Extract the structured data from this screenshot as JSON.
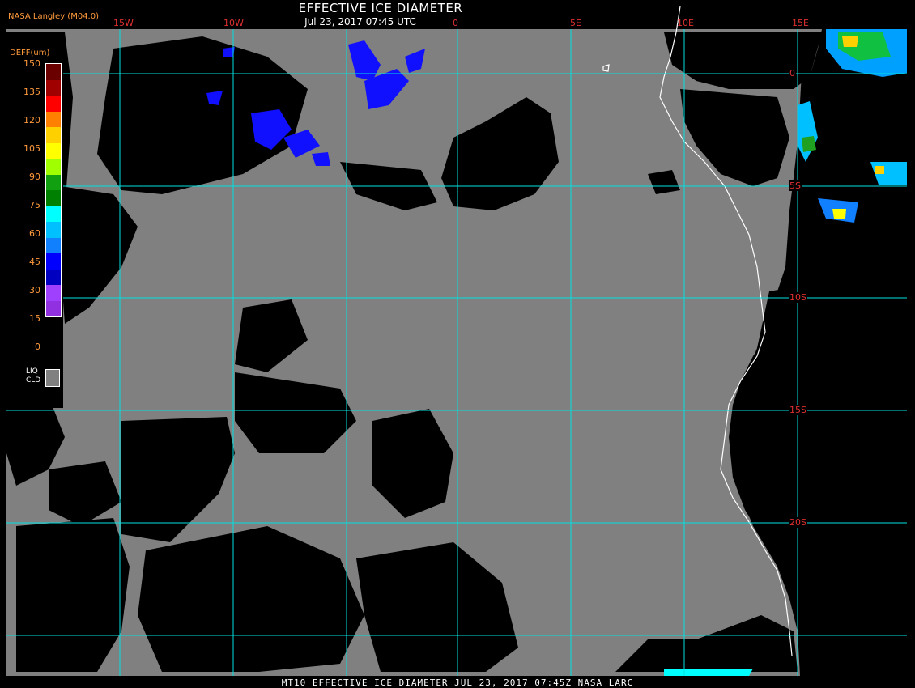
{
  "header": {
    "credit": "NASA Langley (M04.0)",
    "title": "EFFECTIVE ICE DIAMETER",
    "subtitle": "Jul 23, 2017 07:45 UTC"
  },
  "footer": {
    "caption": "MT10  EFFECTIVE ICE DIAMETER   JUL 23, 2017 07:45Z   NASA LARC"
  },
  "grid": {
    "longitudes": [
      "15W",
      "10W",
      "0",
      "5E",
      "10E",
      "15E"
    ],
    "latitudes": [
      "0",
      "5S",
      "10S",
      "15S",
      "20S"
    ]
  },
  "legend": {
    "title": "DEFF(um)",
    "ticks": [
      "150",
      "135",
      "120",
      "105",
      "90",
      "75",
      "60",
      "45",
      "30",
      "15",
      "0"
    ],
    "liquid_label_line1": "LIQ",
    "liquid_label_line2": "CLD",
    "colors": [
      "#6b0000",
      "#a00000",
      "#ff0000",
      "#ff7f00",
      "#ffd000",
      "#ffff00",
      "#a0ff00",
      "#10a010",
      "#008000",
      "#00ffff",
      "#00c0ff",
      "#1080ff",
      "#0000ff",
      "#0000c0",
      "#a040ff",
      "#9030e0"
    ]
  },
  "colors": {
    "liquid_cloud": "#808080",
    "clear": "#000000",
    "grid": "#00e0e0",
    "grid_label": "#e03030",
    "coastline": "#ffffff"
  }
}
